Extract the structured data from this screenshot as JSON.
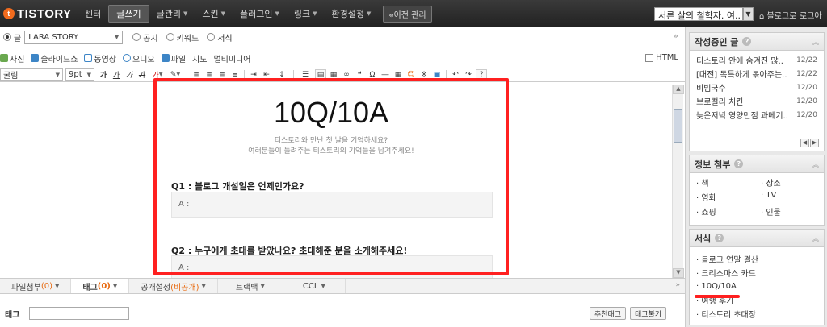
{
  "brand": {
    "logo_text": "TISTORY",
    "logo_mark": "t"
  },
  "nav": {
    "items": [
      {
        "label": "센터",
        "active": false,
        "dropdown": false
      },
      {
        "label": "글쓰기",
        "active": true,
        "dropdown": false
      },
      {
        "label": "글관리",
        "active": false,
        "dropdown": true
      },
      {
        "label": "스킨",
        "active": false,
        "dropdown": true
      },
      {
        "label": "플러그인",
        "active": false,
        "dropdown": true
      },
      {
        "label": "링크",
        "active": false,
        "dropdown": true
      },
      {
        "label": "환경설정",
        "active": false,
        "dropdown": true
      }
    ],
    "prev_admin": "«이전 관리"
  },
  "top_right": {
    "blog_select": "서른 살의 철학자. 여..",
    "blog_link": "블로그로",
    "logout": "로그아"
  },
  "options": {
    "type_post": "글",
    "category": "LARA STORY",
    "type_notice": "공지",
    "type_keyword": "키워드",
    "type_format": "서식",
    "collapse": "»"
  },
  "insert": {
    "photo": "사진",
    "slideshow": "슬라이드쇼",
    "video": "동영상",
    "audio": "오디오",
    "file": "파일",
    "map": "지도",
    "multimedia": "멀티미디어",
    "html": "HTML"
  },
  "format_toolbar": {
    "font": "굴림",
    "size": "9pt",
    "buttons": [
      "가",
      "가",
      "가",
      "가",
      "가"
    ]
  },
  "content": {
    "title": "10Q/10A",
    "sub1": "티스토리와 만난 첫 날을 기억하세요?",
    "sub2": "여러분들이 들려주는 티스토리의 기억들을 남겨주세요!",
    "q1": "Q1 : 블로그 개설일은 언제인가요?",
    "a1": "A :",
    "q2": "Q2 : 누구에게 초대를 받았나요? 초대해준 분을 소개해주세요!",
    "a2": "A :"
  },
  "bottom_tabs": {
    "attach": "파일첨부",
    "attach_count": "(0)",
    "tag": "태그",
    "tag_count": "(0)",
    "visibility": "공개설정",
    "visibility_value": "(비공개)",
    "trackback": "트랙백",
    "ccl": "CCL",
    "expand": "»"
  },
  "tag_row": {
    "label": "태그",
    "recommend": "추천태그",
    "load": "태그불기"
  },
  "sidebar": {
    "drafts": {
      "title": "작성중인 글",
      "items": [
        {
          "text": "티스토리 안에 숨겨진 많..",
          "date": "12/22"
        },
        {
          "text": "[대전] 독특하게 볶아주는..",
          "date": "12/22"
        },
        {
          "text": "비빔국수",
          "date": "12/20"
        },
        {
          "text": "브로컬리 치킨",
          "date": "12/20"
        },
        {
          "text": "늦은저녁 영양만점 과메기..",
          "date": "12/20"
        }
      ]
    },
    "info": {
      "title": "정보 첨부",
      "items": [
        "책",
        "장소",
        "영화",
        "TV",
        "쇼핑",
        "인물"
      ]
    },
    "format": {
      "title": "서식",
      "items": [
        "블로그 연말 결산",
        "크리스마스 카드",
        "10Q/10A",
        "여행 후기",
        "티스토리 초대장"
      ]
    }
  },
  "colors": {
    "accent": "#e86a10",
    "highlight": "#ff2020",
    "topbar": "#2a2a2a"
  }
}
